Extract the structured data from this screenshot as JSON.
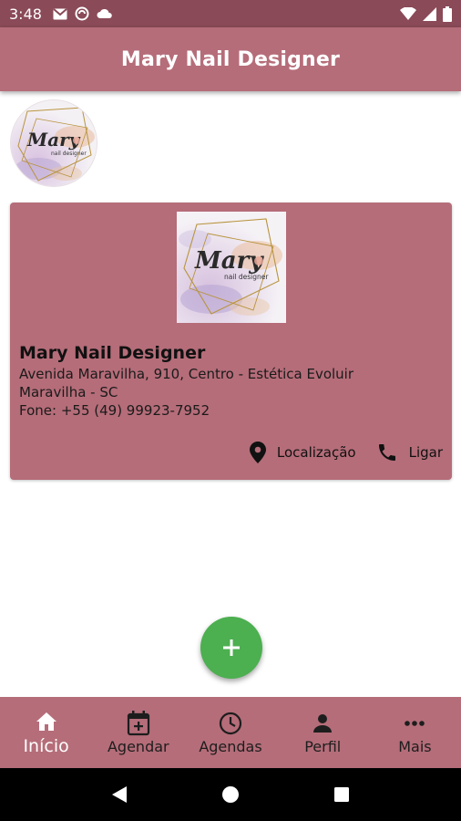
{
  "status_bar": {
    "time": "3:48",
    "left_icons": [
      "gmail-icon",
      "sync-icon",
      "cloud-icon"
    ],
    "right_icons": [
      "wifi-icon",
      "signal-icon",
      "battery-icon"
    ]
  },
  "app_bar": {
    "title": "Mary Nail Designer"
  },
  "avatar": {
    "logo_text": "Mary",
    "logo_subtext": "nail designer"
  },
  "business_card": {
    "logo_text": "Mary",
    "logo_subtext": "nail designer",
    "name": "Mary Nail Designer",
    "address_line1": "Avenida Maravilha, 910, Centro - Estética Evoluir",
    "address_line2": "Maravilha - SC",
    "phone": "Fone: +55 (49) 99923-7952",
    "actions": {
      "location_label": "Localização",
      "call_label": "Ligar"
    }
  },
  "fab": {
    "icon": "plus-icon"
  },
  "bottom_nav": {
    "items": [
      {
        "label": "Início",
        "icon": "home-icon",
        "active": true
      },
      {
        "label": "Agendar",
        "icon": "calendar-add-icon",
        "active": false
      },
      {
        "label": "Agendas",
        "icon": "clock-icon",
        "active": false
      },
      {
        "label": "Perfil",
        "icon": "person-icon",
        "active": false
      },
      {
        "label": "Mais",
        "icon": "more-horizontal-icon",
        "active": false
      }
    ]
  },
  "colors": {
    "primary": "#b56d79",
    "status_bar": "#8a4a58",
    "fab": "#4caf50"
  }
}
